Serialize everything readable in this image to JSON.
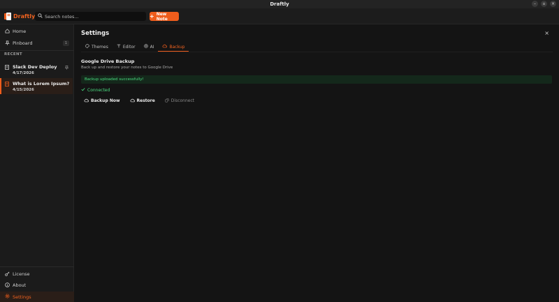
{
  "window": {
    "title": "Draftly"
  },
  "brand": {
    "name": "Draftly",
    "accent": "#ef5d1c"
  },
  "search": {
    "placeholder": "Search notes..."
  },
  "new_note": {
    "label": "New Note"
  },
  "sidebar": {
    "nav": [
      {
        "label": "Home",
        "icon": "home-icon"
      },
      {
        "label": "Pinboard",
        "icon": "pin-icon",
        "badge": "1"
      }
    ],
    "recent_label": "RECENT",
    "notes": [
      {
        "title": "Slack Dev Deploy",
        "date": "4/17/2026",
        "pinned": true
      },
      {
        "title": "What is Lorem Ipsum?",
        "date": "4/15/2026",
        "active": true
      }
    ],
    "footer": [
      {
        "label": "License",
        "icon": "key-icon"
      },
      {
        "label": "About",
        "icon": "info-icon"
      },
      {
        "label": "Settings",
        "icon": "gear-icon",
        "active": true
      }
    ]
  },
  "settings": {
    "title": "Settings",
    "close": "×",
    "tabs": [
      {
        "label": "Themes",
        "icon": "palette-icon"
      },
      {
        "label": "Editor",
        "icon": "text-icon"
      },
      {
        "label": "AI",
        "icon": "globe-icon"
      },
      {
        "label": "Backup",
        "icon": "cloud-icon",
        "active": true
      }
    ],
    "backup": {
      "title": "Google Drive Backup",
      "subtitle": "Back up and restore your notes to Google Drive",
      "alert": "Backup uploaded successfully!",
      "status": "Connected",
      "actions": {
        "backup_now": "Backup Now",
        "restore": "Restore",
        "disconnect": "Disconnect"
      }
    }
  }
}
